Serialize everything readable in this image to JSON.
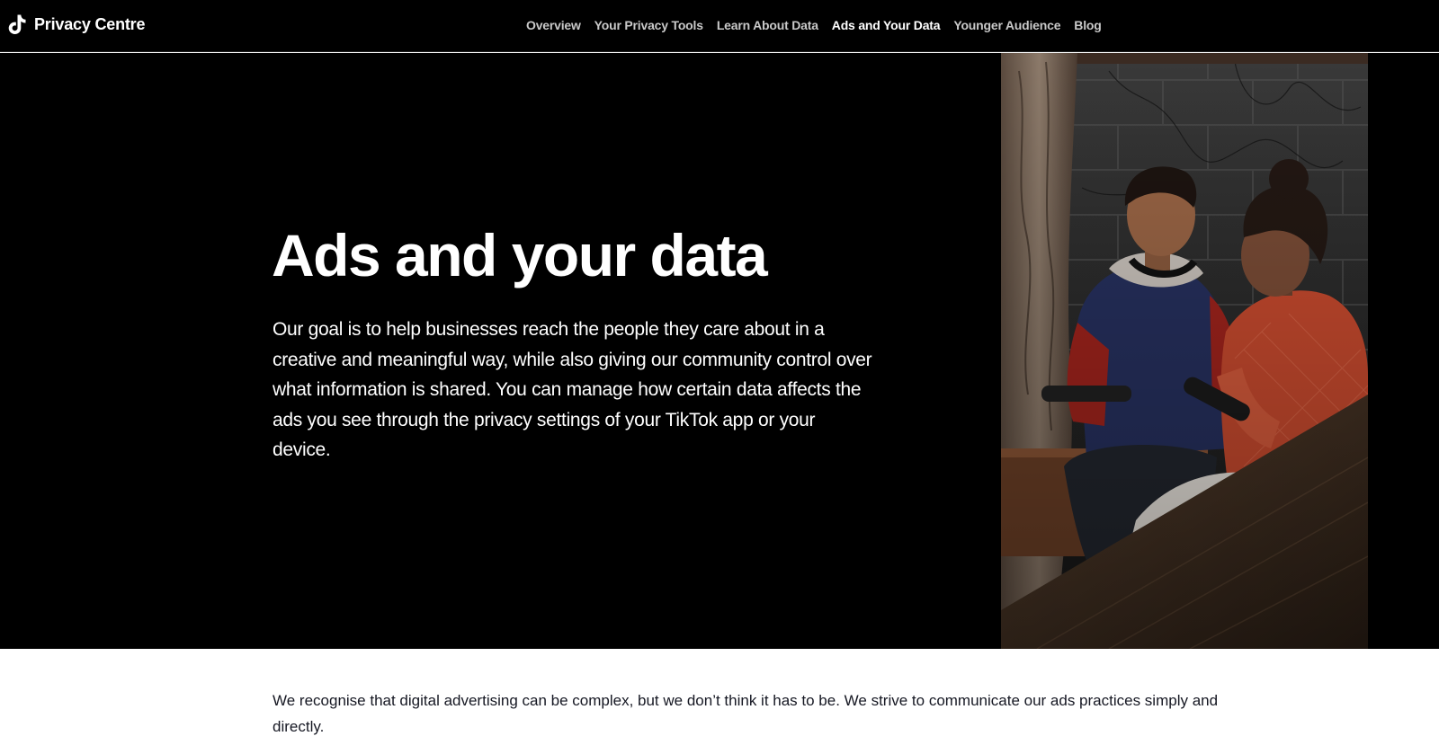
{
  "header": {
    "brand_name": "Privacy Centre",
    "nav": [
      {
        "label": "Overview",
        "active": false
      },
      {
        "label": "Your Privacy Tools",
        "active": false
      },
      {
        "label": "Learn About Data",
        "active": false
      },
      {
        "label": "Ads and Your Data",
        "active": true
      },
      {
        "label": "Younger Audience",
        "active": false
      },
      {
        "label": "Blog",
        "active": false
      }
    ]
  },
  "hero": {
    "title": "Ads and your data",
    "description": "Our goal is to help businesses reach the people they care about in a creative and meaningful way, while also giving our community control over what information is shared. You can manage how certain data affects the ads you see through the privacy settings of your TikTok app or your device."
  },
  "intro": {
    "text": "We recognise that digital advertising can be complex, but we don’t think it has to be. We strive to communicate our ads practices simply and directly."
  },
  "colors": {
    "header_bg": "#000000",
    "hero_bg": "#000000",
    "nav_text": "#c9c9c9",
    "nav_active": "#ffffff",
    "body_text": "#161823"
  },
  "icons": {
    "brand_logo": "tiktok-note-icon"
  }
}
